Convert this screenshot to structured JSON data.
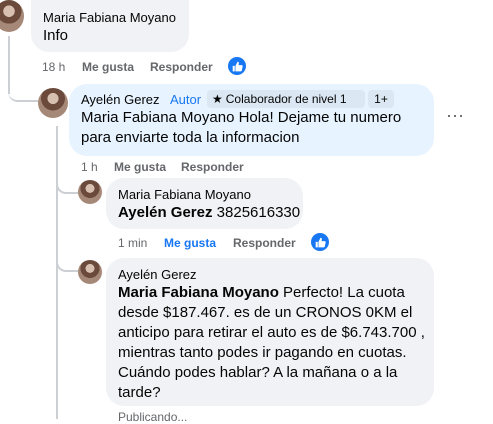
{
  "comments": [
    {
      "author": "Maria Fabiana Moyano",
      "text": "Info",
      "time": "18 h",
      "like_label": "Me gusta",
      "reply_label": "Responder",
      "liked": false
    },
    {
      "author": "Ayelén Gerez",
      "author_tag": "Autor",
      "badge_label": "Colaborador de nivel 1",
      "badge_count": "1+",
      "mention": "Maria Fabiana Moyano",
      "text": "Hola! Dejame tu numero para enviarte toda la informacion",
      "time": "1 h",
      "like_label": "Me gusta",
      "reply_label": "Responder",
      "liked": false
    },
    {
      "author": "Maria Fabiana Moyano",
      "mention": "Ayelén Gerez",
      "text": "3825616330",
      "time": "1 min",
      "like_label": "Me gusta",
      "reply_label": "Responder",
      "liked": true
    },
    {
      "author": "Ayelén Gerez",
      "mention": "Maria Fabiana Moyano",
      "text": "Perfecto! La cuota desde $187.467. es de un CRONOS 0KM el anticipo para retirar el auto es de $6.743.700 , mientras tanto podes ir pagando en cuotas. Cuándo podes hablar? A la mañana o a la tarde?",
      "status": "Publicando..."
    }
  ],
  "icons": {
    "like": "thumbs-up-icon",
    "more": "more-options-icon",
    "badge": "star-icon"
  },
  "colors": {
    "accent": "#1877f2",
    "bubble": "#f0f2f5",
    "bubble_highlight": "#e7f3ff",
    "meta": "#65676b"
  }
}
